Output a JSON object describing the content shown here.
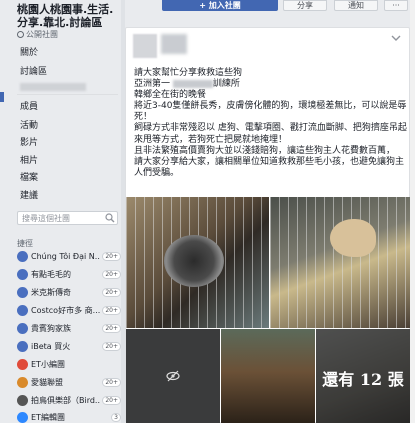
{
  "topbar": {
    "join_label": "+ 加入社團",
    "share_label": "分享",
    "notify_label": "通知",
    "more_label": "···"
  },
  "sidebar": {
    "group_title": "桃園人桃園事.生活.分享.靠北.討論區",
    "group_type": "公開社團",
    "nav": {
      "about": "關於",
      "discussion": "討論區",
      "members": "成員",
      "events": "活動",
      "videos": "影片",
      "photos": "相片",
      "files": "檔案",
      "suggestions": "建議"
    },
    "search_placeholder": "搜尋這個社團",
    "shortcuts_label": "捷徑",
    "shortcuts": [
      {
        "name": "Chúng Tôi Đại N...",
        "count": "20+"
      },
      {
        "name": "有點毛毛的",
        "count": "20+"
      },
      {
        "name": "米克斯傳奇",
        "count": "20+"
      },
      {
        "name": "Costco好市多 商...",
        "count": "20+"
      },
      {
        "name": "貴賓狗家族",
        "count": "20+"
      },
      {
        "name": "iBeta 買火",
        "count": "20+"
      },
      {
        "name": "ET小編團",
        "count": ""
      },
      {
        "name": "愛貓聯盟",
        "count": "20+"
      },
      {
        "name": "拍鳥俱樂部（Bird...",
        "count": "20+"
      },
      {
        "name": "ET編輯團",
        "count": "3"
      }
    ],
    "colors": {
      "accent": "#4267b2"
    }
  },
  "post": {
    "lines": [
      "請大家幫忙分享救救這些狗",
      "亞洲第一",
      "韓鄉全在街的晚餐",
      "將近3-40隻僅餅長秀，皮膚傍化體的狗，環境極差無比，可以說是辱",
      "死！",
      "飼碌方式非常殘忍以 虐狗、電擊項圈、戳打流血斷脚、把狗擠座吊起",
      "來甩等方式，若狗死亡把屍就地掩埋！",
      "且非法繁殖高價賣狗大並以淺錢賠狗，讓這些狗主人花費數百萬，",
      "請大家分享給大家，讓相關單位知道救救那些毛小孩，也避免讓狗主",
      "人們受騙。"
    ],
    "line2_suffix": "訓練所",
    "more_photos": "還有 12 張"
  }
}
